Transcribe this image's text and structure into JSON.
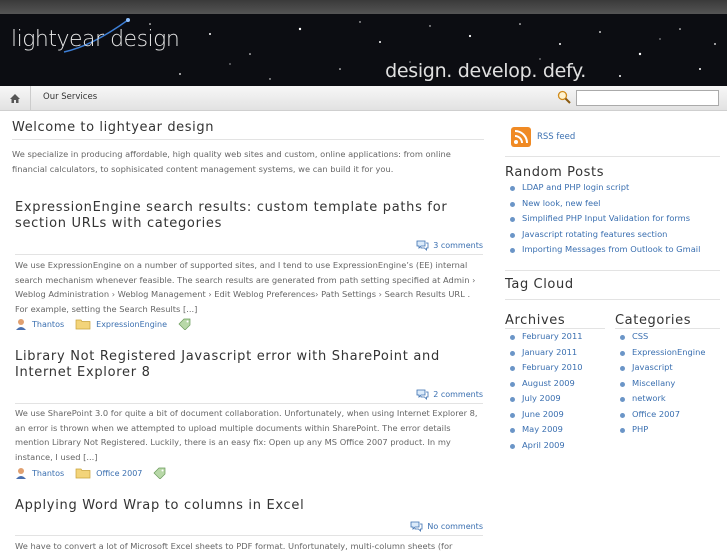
{
  "header": {
    "logo": "lightyear design",
    "tagline": "design. develop. defy."
  },
  "nav": {
    "home_icon": "home-icon",
    "items": [
      {
        "label": "Our Services"
      }
    ],
    "search_icon": "magnifier-icon",
    "search_value": "",
    "search_placeholder": ""
  },
  "welcome": {
    "title": "Welcome to lightyear design",
    "text": "We specialize in producing affordable, high quality web sites and custom, online applications: from online financial calculators, to sophisicated content management systems, we can build it for you."
  },
  "posts": [
    {
      "title": "ExpressionEngine search results: custom template paths for section URLs with categories",
      "comments": "3 comments",
      "excerpt": "We use ExpressionEngine on a number of supported sites, and I tend to use ExpressionEngine’s (EE) internal search mechanism whenever feasible. The search results are generated from path setting specified at Admin › Weblog Administration › Weblog Management › Edit Weblog Preferences› Path Settings › Search Results URL . For example, setting the Search Results [...]",
      "author": "Thantos",
      "category": "ExpressionEngine"
    },
    {
      "title": "Library Not Registered Javascript error with SharePoint and Internet Explorer 8",
      "comments": "2 comments",
      "excerpt": "We use SharePoint 3.0 for quite a bit of document collaboration. Unfortunately, when using Internet Explorer 8, an error is thrown when we attempted to upload multiple documents within SharePoint. The error details mention Library Not Registered. Luckily, there is an easy fix: Open up any MS Office 2007 product. In my instance, I used [...]",
      "author": "Thantos",
      "category": "Office 2007"
    },
    {
      "title": "Applying Word Wrap to columns in Excel",
      "comments": "No comments",
      "excerpt": "We have to convert a lot of Microsoft Excel sheets to PDF format. Unfortunately, multi-column sheets (for"
    }
  ],
  "sidebar": {
    "rss": "RSS feed",
    "random_title": "Random Posts",
    "random_posts": [
      "LDAP and PHP login script",
      "New look, new feel",
      "Simplified PHP Input Validation for forms",
      "Javascript rotating features section",
      "Importing Messages from Outlook to Gmail"
    ],
    "tag_cloud_title": "Tag Cloud",
    "archives_title": "Archives",
    "archives": [
      "February 2011",
      "January 2011",
      "February 2010",
      "August 2009",
      "July 2009",
      "June 2009",
      "May 2009",
      "April 2009"
    ],
    "categories_title": "Categories",
    "categories": [
      "CSS",
      "ExpressionEngine",
      "Javascript",
      "Miscellany",
      "network",
      "Office 2007",
      "PHP"
    ]
  },
  "colors": {
    "link": "#3a6fb0",
    "rss": "#f08a24",
    "header_bg": "#0c0d12"
  }
}
